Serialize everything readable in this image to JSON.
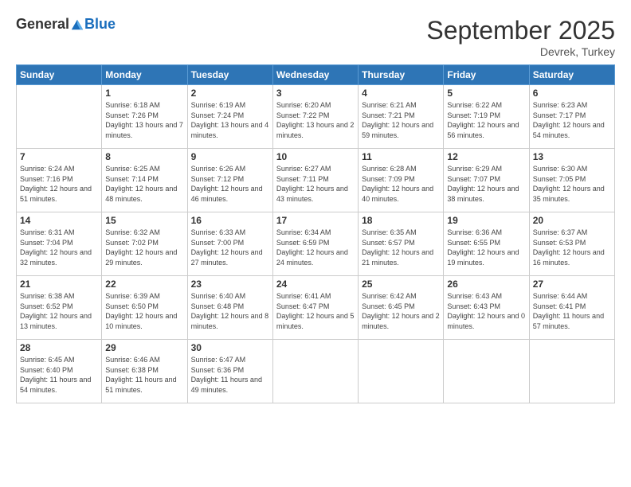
{
  "logo": {
    "general": "General",
    "blue": "Blue"
  },
  "header": {
    "month": "September 2025",
    "location": "Devrek, Turkey"
  },
  "days_of_week": [
    "Sunday",
    "Monday",
    "Tuesday",
    "Wednesday",
    "Thursday",
    "Friday",
    "Saturday"
  ],
  "weeks": [
    [
      {
        "day": "",
        "sunrise": "",
        "sunset": "",
        "daylight": ""
      },
      {
        "day": "1",
        "sunrise": "Sunrise: 6:18 AM",
        "sunset": "Sunset: 7:26 PM",
        "daylight": "Daylight: 13 hours and 7 minutes."
      },
      {
        "day": "2",
        "sunrise": "Sunrise: 6:19 AM",
        "sunset": "Sunset: 7:24 PM",
        "daylight": "Daylight: 13 hours and 4 minutes."
      },
      {
        "day": "3",
        "sunrise": "Sunrise: 6:20 AM",
        "sunset": "Sunset: 7:22 PM",
        "daylight": "Daylight: 13 hours and 2 minutes."
      },
      {
        "day": "4",
        "sunrise": "Sunrise: 6:21 AM",
        "sunset": "Sunset: 7:21 PM",
        "daylight": "Daylight: 12 hours and 59 minutes."
      },
      {
        "day": "5",
        "sunrise": "Sunrise: 6:22 AM",
        "sunset": "Sunset: 7:19 PM",
        "daylight": "Daylight: 12 hours and 56 minutes."
      },
      {
        "day": "6",
        "sunrise": "Sunrise: 6:23 AM",
        "sunset": "Sunset: 7:17 PM",
        "daylight": "Daylight: 12 hours and 54 minutes."
      }
    ],
    [
      {
        "day": "7",
        "sunrise": "Sunrise: 6:24 AM",
        "sunset": "Sunset: 7:16 PM",
        "daylight": "Daylight: 12 hours and 51 minutes."
      },
      {
        "day": "8",
        "sunrise": "Sunrise: 6:25 AM",
        "sunset": "Sunset: 7:14 PM",
        "daylight": "Daylight: 12 hours and 48 minutes."
      },
      {
        "day": "9",
        "sunrise": "Sunrise: 6:26 AM",
        "sunset": "Sunset: 7:12 PM",
        "daylight": "Daylight: 12 hours and 46 minutes."
      },
      {
        "day": "10",
        "sunrise": "Sunrise: 6:27 AM",
        "sunset": "Sunset: 7:11 PM",
        "daylight": "Daylight: 12 hours and 43 minutes."
      },
      {
        "day": "11",
        "sunrise": "Sunrise: 6:28 AM",
        "sunset": "Sunset: 7:09 PM",
        "daylight": "Daylight: 12 hours and 40 minutes."
      },
      {
        "day": "12",
        "sunrise": "Sunrise: 6:29 AM",
        "sunset": "Sunset: 7:07 PM",
        "daylight": "Daylight: 12 hours and 38 minutes."
      },
      {
        "day": "13",
        "sunrise": "Sunrise: 6:30 AM",
        "sunset": "Sunset: 7:05 PM",
        "daylight": "Daylight: 12 hours and 35 minutes."
      }
    ],
    [
      {
        "day": "14",
        "sunrise": "Sunrise: 6:31 AM",
        "sunset": "Sunset: 7:04 PM",
        "daylight": "Daylight: 12 hours and 32 minutes."
      },
      {
        "day": "15",
        "sunrise": "Sunrise: 6:32 AM",
        "sunset": "Sunset: 7:02 PM",
        "daylight": "Daylight: 12 hours and 29 minutes."
      },
      {
        "day": "16",
        "sunrise": "Sunrise: 6:33 AM",
        "sunset": "Sunset: 7:00 PM",
        "daylight": "Daylight: 12 hours and 27 minutes."
      },
      {
        "day": "17",
        "sunrise": "Sunrise: 6:34 AM",
        "sunset": "Sunset: 6:59 PM",
        "daylight": "Daylight: 12 hours and 24 minutes."
      },
      {
        "day": "18",
        "sunrise": "Sunrise: 6:35 AM",
        "sunset": "Sunset: 6:57 PM",
        "daylight": "Daylight: 12 hours and 21 minutes."
      },
      {
        "day": "19",
        "sunrise": "Sunrise: 6:36 AM",
        "sunset": "Sunset: 6:55 PM",
        "daylight": "Daylight: 12 hours and 19 minutes."
      },
      {
        "day": "20",
        "sunrise": "Sunrise: 6:37 AM",
        "sunset": "Sunset: 6:53 PM",
        "daylight": "Daylight: 12 hours and 16 minutes."
      }
    ],
    [
      {
        "day": "21",
        "sunrise": "Sunrise: 6:38 AM",
        "sunset": "Sunset: 6:52 PM",
        "daylight": "Daylight: 12 hours and 13 minutes."
      },
      {
        "day": "22",
        "sunrise": "Sunrise: 6:39 AM",
        "sunset": "Sunset: 6:50 PM",
        "daylight": "Daylight: 12 hours and 10 minutes."
      },
      {
        "day": "23",
        "sunrise": "Sunrise: 6:40 AM",
        "sunset": "Sunset: 6:48 PM",
        "daylight": "Daylight: 12 hours and 8 minutes."
      },
      {
        "day": "24",
        "sunrise": "Sunrise: 6:41 AM",
        "sunset": "Sunset: 6:47 PM",
        "daylight": "Daylight: 12 hours and 5 minutes."
      },
      {
        "day": "25",
        "sunrise": "Sunrise: 6:42 AM",
        "sunset": "Sunset: 6:45 PM",
        "daylight": "Daylight: 12 hours and 2 minutes."
      },
      {
        "day": "26",
        "sunrise": "Sunrise: 6:43 AM",
        "sunset": "Sunset: 6:43 PM",
        "daylight": "Daylight: 12 hours and 0 minutes."
      },
      {
        "day": "27",
        "sunrise": "Sunrise: 6:44 AM",
        "sunset": "Sunset: 6:41 PM",
        "daylight": "Daylight: 11 hours and 57 minutes."
      }
    ],
    [
      {
        "day": "28",
        "sunrise": "Sunrise: 6:45 AM",
        "sunset": "Sunset: 6:40 PM",
        "daylight": "Daylight: 11 hours and 54 minutes."
      },
      {
        "day": "29",
        "sunrise": "Sunrise: 6:46 AM",
        "sunset": "Sunset: 6:38 PM",
        "daylight": "Daylight: 11 hours and 51 minutes."
      },
      {
        "day": "30",
        "sunrise": "Sunrise: 6:47 AM",
        "sunset": "Sunset: 6:36 PM",
        "daylight": "Daylight: 11 hours and 49 minutes."
      },
      {
        "day": "",
        "sunrise": "",
        "sunset": "",
        "daylight": ""
      },
      {
        "day": "",
        "sunrise": "",
        "sunset": "",
        "daylight": ""
      },
      {
        "day": "",
        "sunrise": "",
        "sunset": "",
        "daylight": ""
      },
      {
        "day": "",
        "sunrise": "",
        "sunset": "",
        "daylight": ""
      }
    ]
  ]
}
